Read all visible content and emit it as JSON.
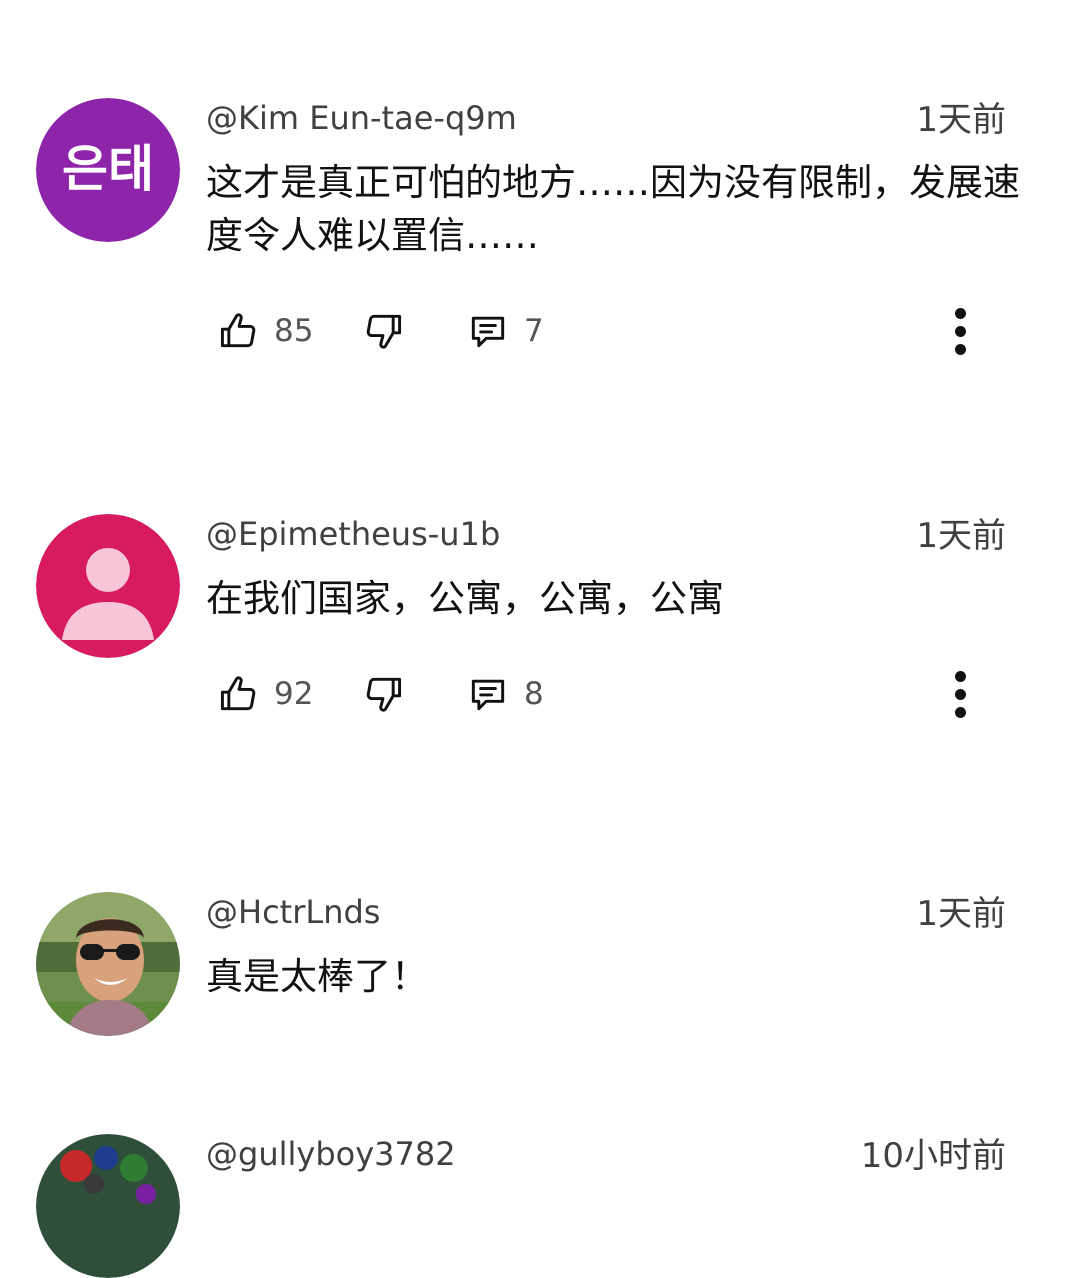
{
  "comments": [
    {
      "handle": "@Kim Eun-tae-q9m",
      "time": "1天前",
      "text": "这才是真正可怕的地方……因为没有限制，发展速度令人难以置信……",
      "likes": "85",
      "replies": "7",
      "avatar": {
        "type": "text",
        "text": "은태",
        "color": "#8e24aa"
      }
    },
    {
      "handle": "@Epimetheus-u1b",
      "time": "1天前",
      "text": "在我们国家，公寓，公寓，公寓",
      "likes": "92",
      "replies": "8",
      "avatar": {
        "type": "default-person",
        "color": "#d81b60"
      }
    },
    {
      "handle": "@HctrLnds",
      "time": "1天前",
      "text": "真是太棒了！",
      "avatar": {
        "type": "photo"
      }
    },
    {
      "handle": "@gullyboy3782",
      "time": "10小时前",
      "avatar": {
        "type": "photo"
      }
    }
  ],
  "icons": {
    "like": "thumbs-up-icon",
    "dislike": "thumbs-down-icon",
    "reply": "comment-icon",
    "more": "more-vertical-icon"
  }
}
